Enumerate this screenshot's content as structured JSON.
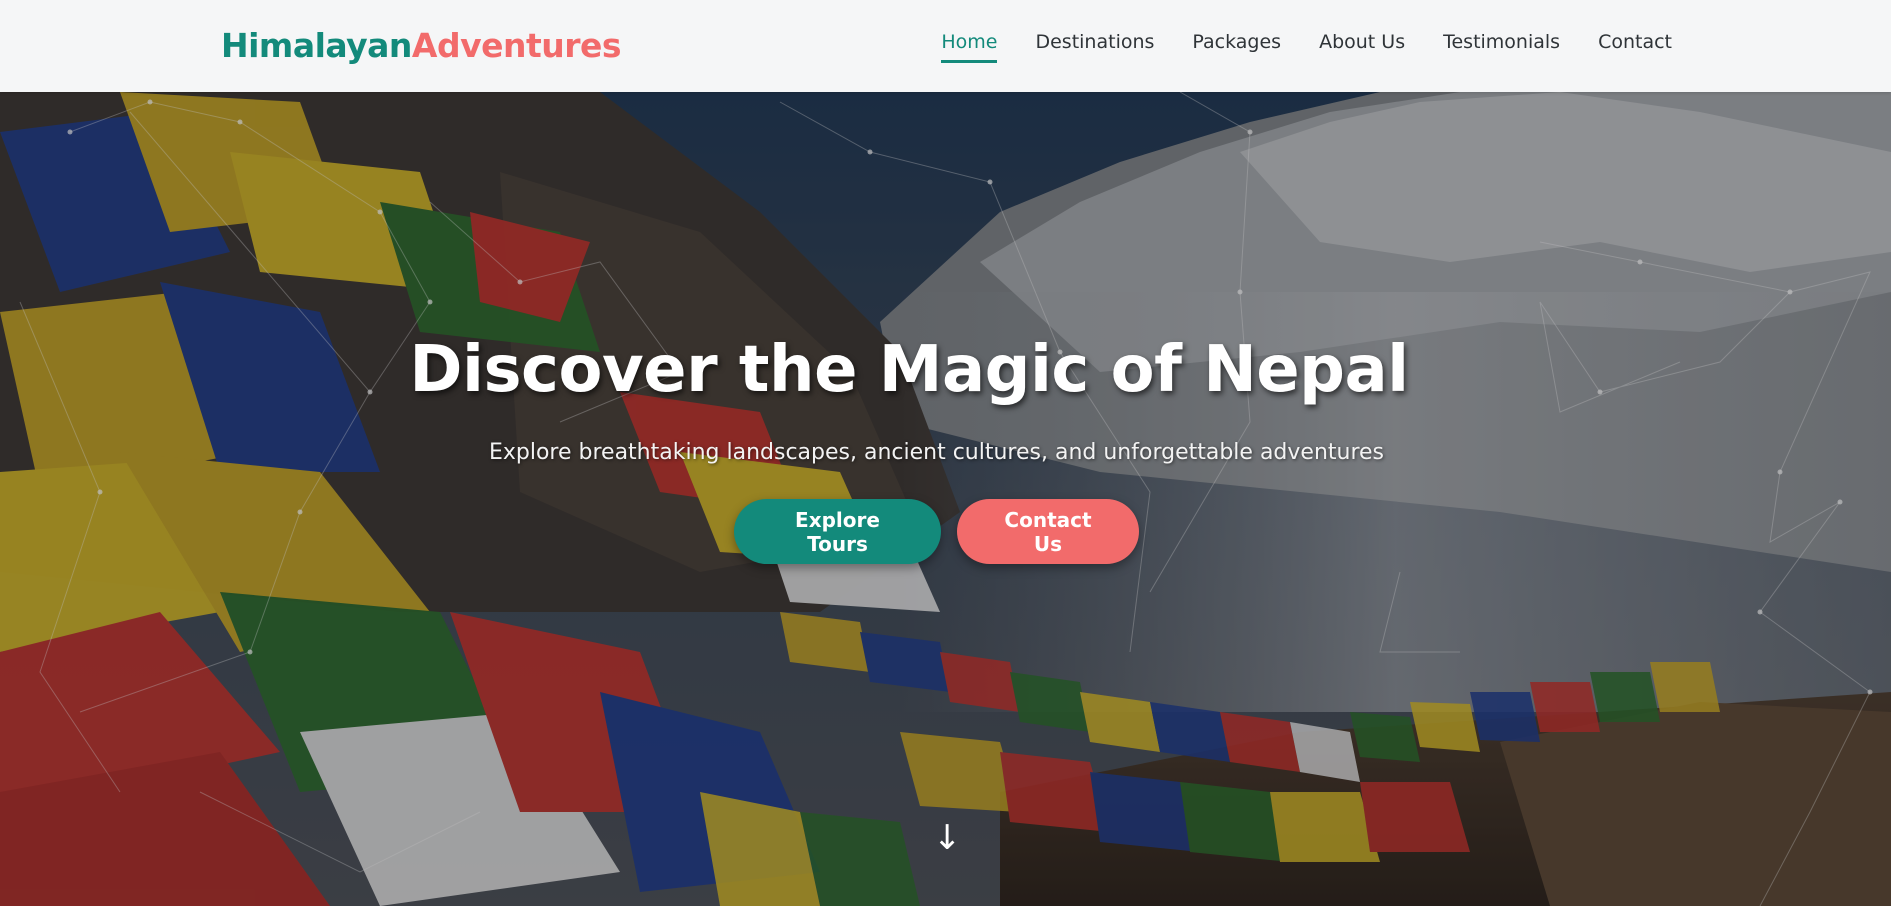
{
  "theme": {
    "primary": "#138a7b",
    "accent": "#f26b6b"
  },
  "brand": {
    "part1": "Himalayan",
    "part2": "Adventures"
  },
  "nav": {
    "items": [
      {
        "label": "Home",
        "active": true
      },
      {
        "label": "Destinations",
        "active": false
      },
      {
        "label": "Packages",
        "active": false
      },
      {
        "label": "About Us",
        "active": false
      },
      {
        "label": "Testimonials",
        "active": false
      },
      {
        "label": "Contact",
        "active": false
      }
    ]
  },
  "hero": {
    "title": "Discover the Magic of Nepal",
    "subtitle": "Explore breathtaking landscapes, ancient cultures, and unforgettable adventures",
    "primary_button": "Explore Tours",
    "secondary_button": "Contact Us",
    "scroll_icon": "arrow-down-icon",
    "background_description_icon": "mountain-prayer-flags-image"
  }
}
